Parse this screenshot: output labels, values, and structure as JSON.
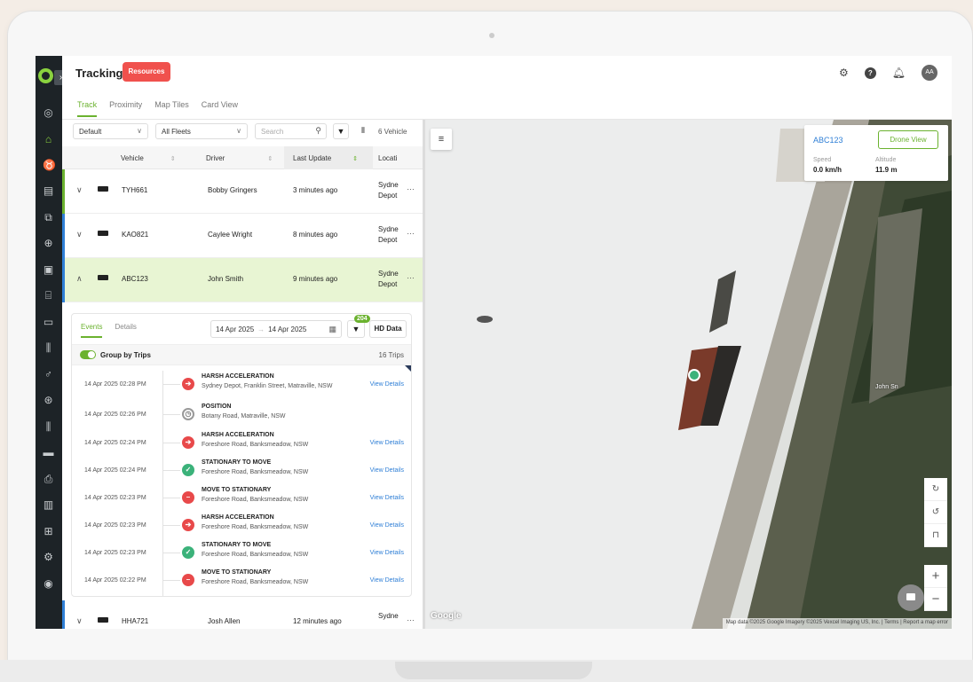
{
  "header": {
    "title": "Tracking",
    "resources_label": "Resources",
    "tabs": [
      "Track",
      "Proximity",
      "Map Tiles",
      "Card View"
    ],
    "avatar_initials": "AA",
    "help_glyph": "?"
  },
  "filters": {
    "view": "Default",
    "fleet": "All Fleets",
    "search_placeholder": "Search",
    "vehicle_count": "6 Vehicle"
  },
  "table": {
    "columns": [
      "Vehicle",
      "Driver",
      "Last Update",
      "Locati"
    ],
    "rows": [
      {
        "vehicle": "TYH661",
        "driver": "Bobby Gringers",
        "updated": "3 minutes ago",
        "loc1": "Sydne",
        "loc2": "Depot",
        "status_color": "#6bb22f",
        "expanded": false
      },
      {
        "vehicle": "KAO821",
        "driver": "Caylee Wright",
        "updated": "8 minutes ago",
        "loc1": "Sydne",
        "loc2": "Depot",
        "status_color": "#2f7fd6",
        "expanded": false
      },
      {
        "vehicle": "ABC123",
        "driver": "John Smith",
        "updated": "9 minutes ago",
        "loc1": "Sydne",
        "loc2": "Depot",
        "status_color": "#2f7fd6",
        "expanded": true
      },
      {
        "vehicle": "HHA721",
        "driver": "Josh Allen",
        "updated": "12 minutes ago",
        "loc1": "Sydne",
        "loc2": "",
        "status_color": "#2f7fd6",
        "expanded": false
      }
    ]
  },
  "events_card": {
    "tabs": [
      "Events",
      "Details"
    ],
    "date_from": "14 Apr 2025",
    "date_to": "14 Apr 2025",
    "filter_badge": "204",
    "hd_label": "HD Data",
    "group_label": "Group by Trips",
    "trips_count": "16 Trips",
    "view_details_label": "View Details",
    "events": [
      {
        "time": "14 Apr 2025 02:28 PM",
        "title": "HARSH ACCELERATION",
        "address": "Sydney Depot, Franklin Street, Matraville, NSW",
        "kind": "harsh",
        "details": true
      },
      {
        "time": "14 Apr 2025 02:26 PM",
        "title": "POSITION",
        "address": "Botany Road, Matraville, NSW",
        "kind": "position",
        "details": false
      },
      {
        "time": "14 Apr 2025 02:24 PM",
        "title": "HARSH ACCELERATION",
        "address": "Foreshore Road, Banksmeadow, NSW",
        "kind": "harsh",
        "details": true
      },
      {
        "time": "14 Apr 2025 02:24 PM",
        "title": "STATIONARY TO MOVE",
        "address": "Foreshore Road, Banksmeadow, NSW",
        "kind": "move",
        "details": true
      },
      {
        "time": "14 Apr 2025 02:23 PM",
        "title": "MOVE TO STATIONARY",
        "address": "Foreshore Road, Banksmeadow, NSW",
        "kind": "stop",
        "details": true
      },
      {
        "time": "14 Apr 2025 02:23 PM",
        "title": "HARSH ACCELERATION",
        "address": "Foreshore Road, Banksmeadow, NSW",
        "kind": "harsh",
        "details": true
      },
      {
        "time": "14 Apr 2025 02:23 PM",
        "title": "STATIONARY TO MOVE",
        "address": "Foreshore Road, Banksmeadow, NSW",
        "kind": "move",
        "details": true
      },
      {
        "time": "14 Apr 2025 02:22 PM",
        "title": "MOVE TO STATIONARY",
        "address": "Foreshore Road, Banksmeadow, NSW",
        "kind": "stop",
        "details": true
      }
    ]
  },
  "map": {
    "vehicle_id": "ABC123",
    "drone_view_label": "Drone View",
    "speed_label": "Speed",
    "speed_value": "0.0 km/h",
    "altitude_label": "Altitude",
    "altitude_value": "11.9 m",
    "place_label": "John Sn",
    "google_label": "Google",
    "attribution": "Map data ©2025 Google Imagery ©2025 Vexcel Imaging US, Inc.  |  Terms  |  Report a map error"
  },
  "colors": {
    "accent": "#6bb22f",
    "brand_red": "#f0514d",
    "link": "#2f7fd6",
    "harsh": "#e8494a",
    "move": "#3bb27a",
    "stop": "#e8494a"
  }
}
